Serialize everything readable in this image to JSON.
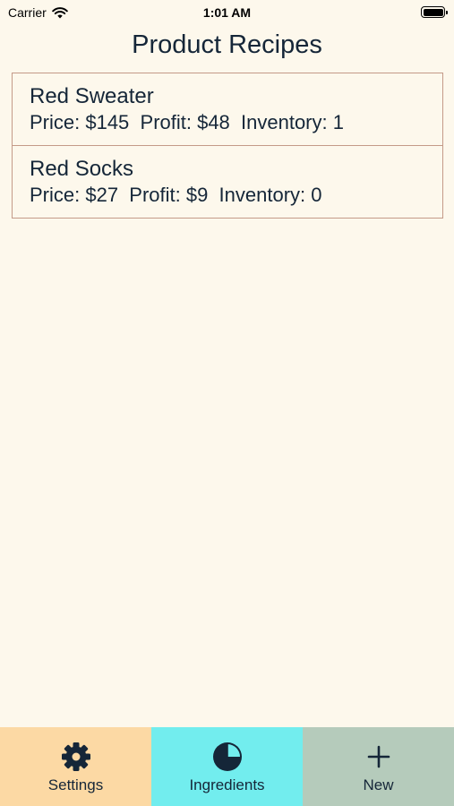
{
  "status_bar": {
    "carrier": "Carrier",
    "time": "1:01 AM",
    "battery_level": 1.0
  },
  "header": {
    "title": "Product Recipes"
  },
  "recipes": [
    {
      "name": "Red Sweater",
      "stats": "Price: $145  Profit: $48  Inventory: 1"
    },
    {
      "name": "Red Socks",
      "stats": "Price: $27  Profit: $9  Inventory: 0"
    }
  ],
  "tabs": [
    {
      "label": "Settings",
      "icon": "gear-icon",
      "color": "#fcd9a4"
    },
    {
      "label": "Ingredients",
      "icon": "pie-chart-icon",
      "color": "#72edee"
    },
    {
      "label": "New",
      "icon": "plus-icon",
      "color": "#b5cbbb"
    }
  ],
  "colors": {
    "background": "#fdf8ec",
    "text": "#152638",
    "card_border": "#c49a88"
  }
}
